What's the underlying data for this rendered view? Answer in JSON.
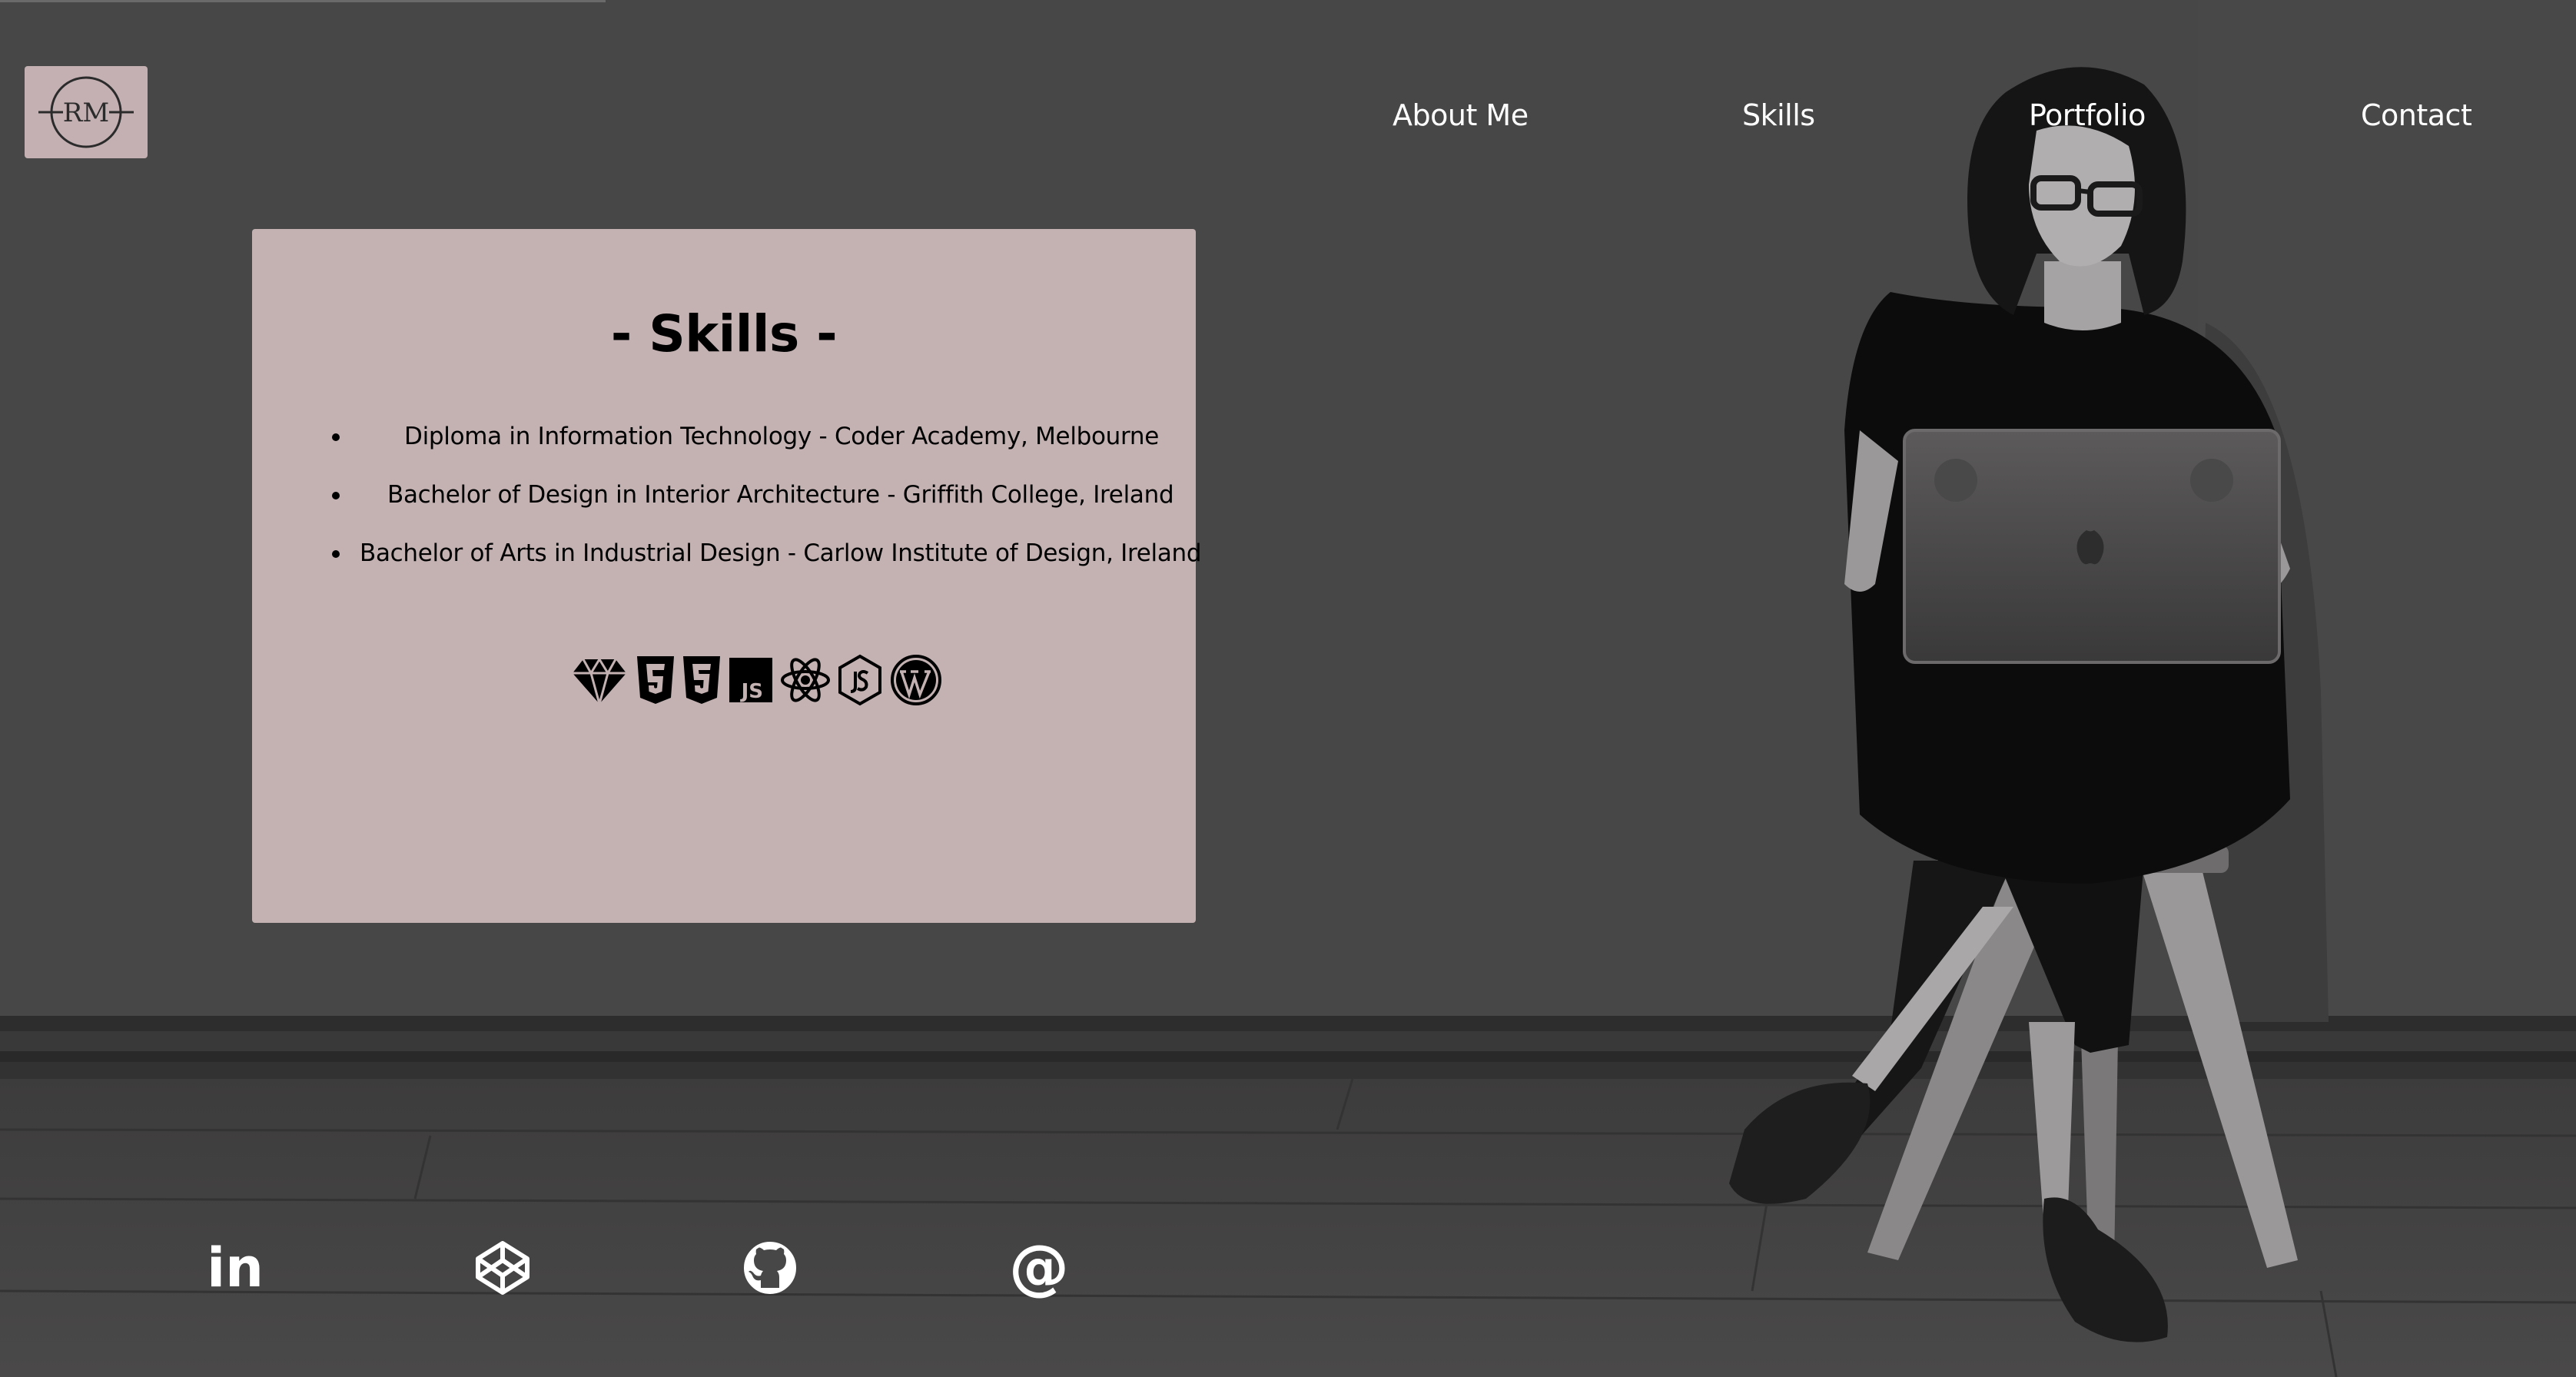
{
  "logo": {
    "initials": "RM"
  },
  "nav": {
    "items": [
      {
        "label": "About Me"
      },
      {
        "label": "Skills"
      },
      {
        "label": "Portfolio"
      },
      {
        "label": "Contact"
      }
    ]
  },
  "skills_card": {
    "title": "- Skills -",
    "education": [
      "Diploma in Information Technology - Coder Academy, Melbourne",
      "Bachelor of Design in Interior Architecture - Griffith College, Ireland",
      "Bachelor of Arts in Industrial Design - Carlow Institute of Design, Ireland"
    ],
    "tech_icons": [
      "sketch-icon",
      "html5-icon",
      "css3-icon",
      "javascript-icon",
      "react-icon",
      "nodejs-icon",
      "wordpress-icon"
    ],
    "js_badge_text": "JS"
  },
  "social": {
    "icons": [
      "linkedin-icon",
      "codepen-icon",
      "github-icon",
      "email-at-icon"
    ],
    "linkedin_text": "in",
    "email_text": "@"
  },
  "colors": {
    "background": "#484747",
    "card": "#c4b2b3",
    "logo_bg": "#c4b0b3",
    "nav_text": "#ffffff"
  }
}
